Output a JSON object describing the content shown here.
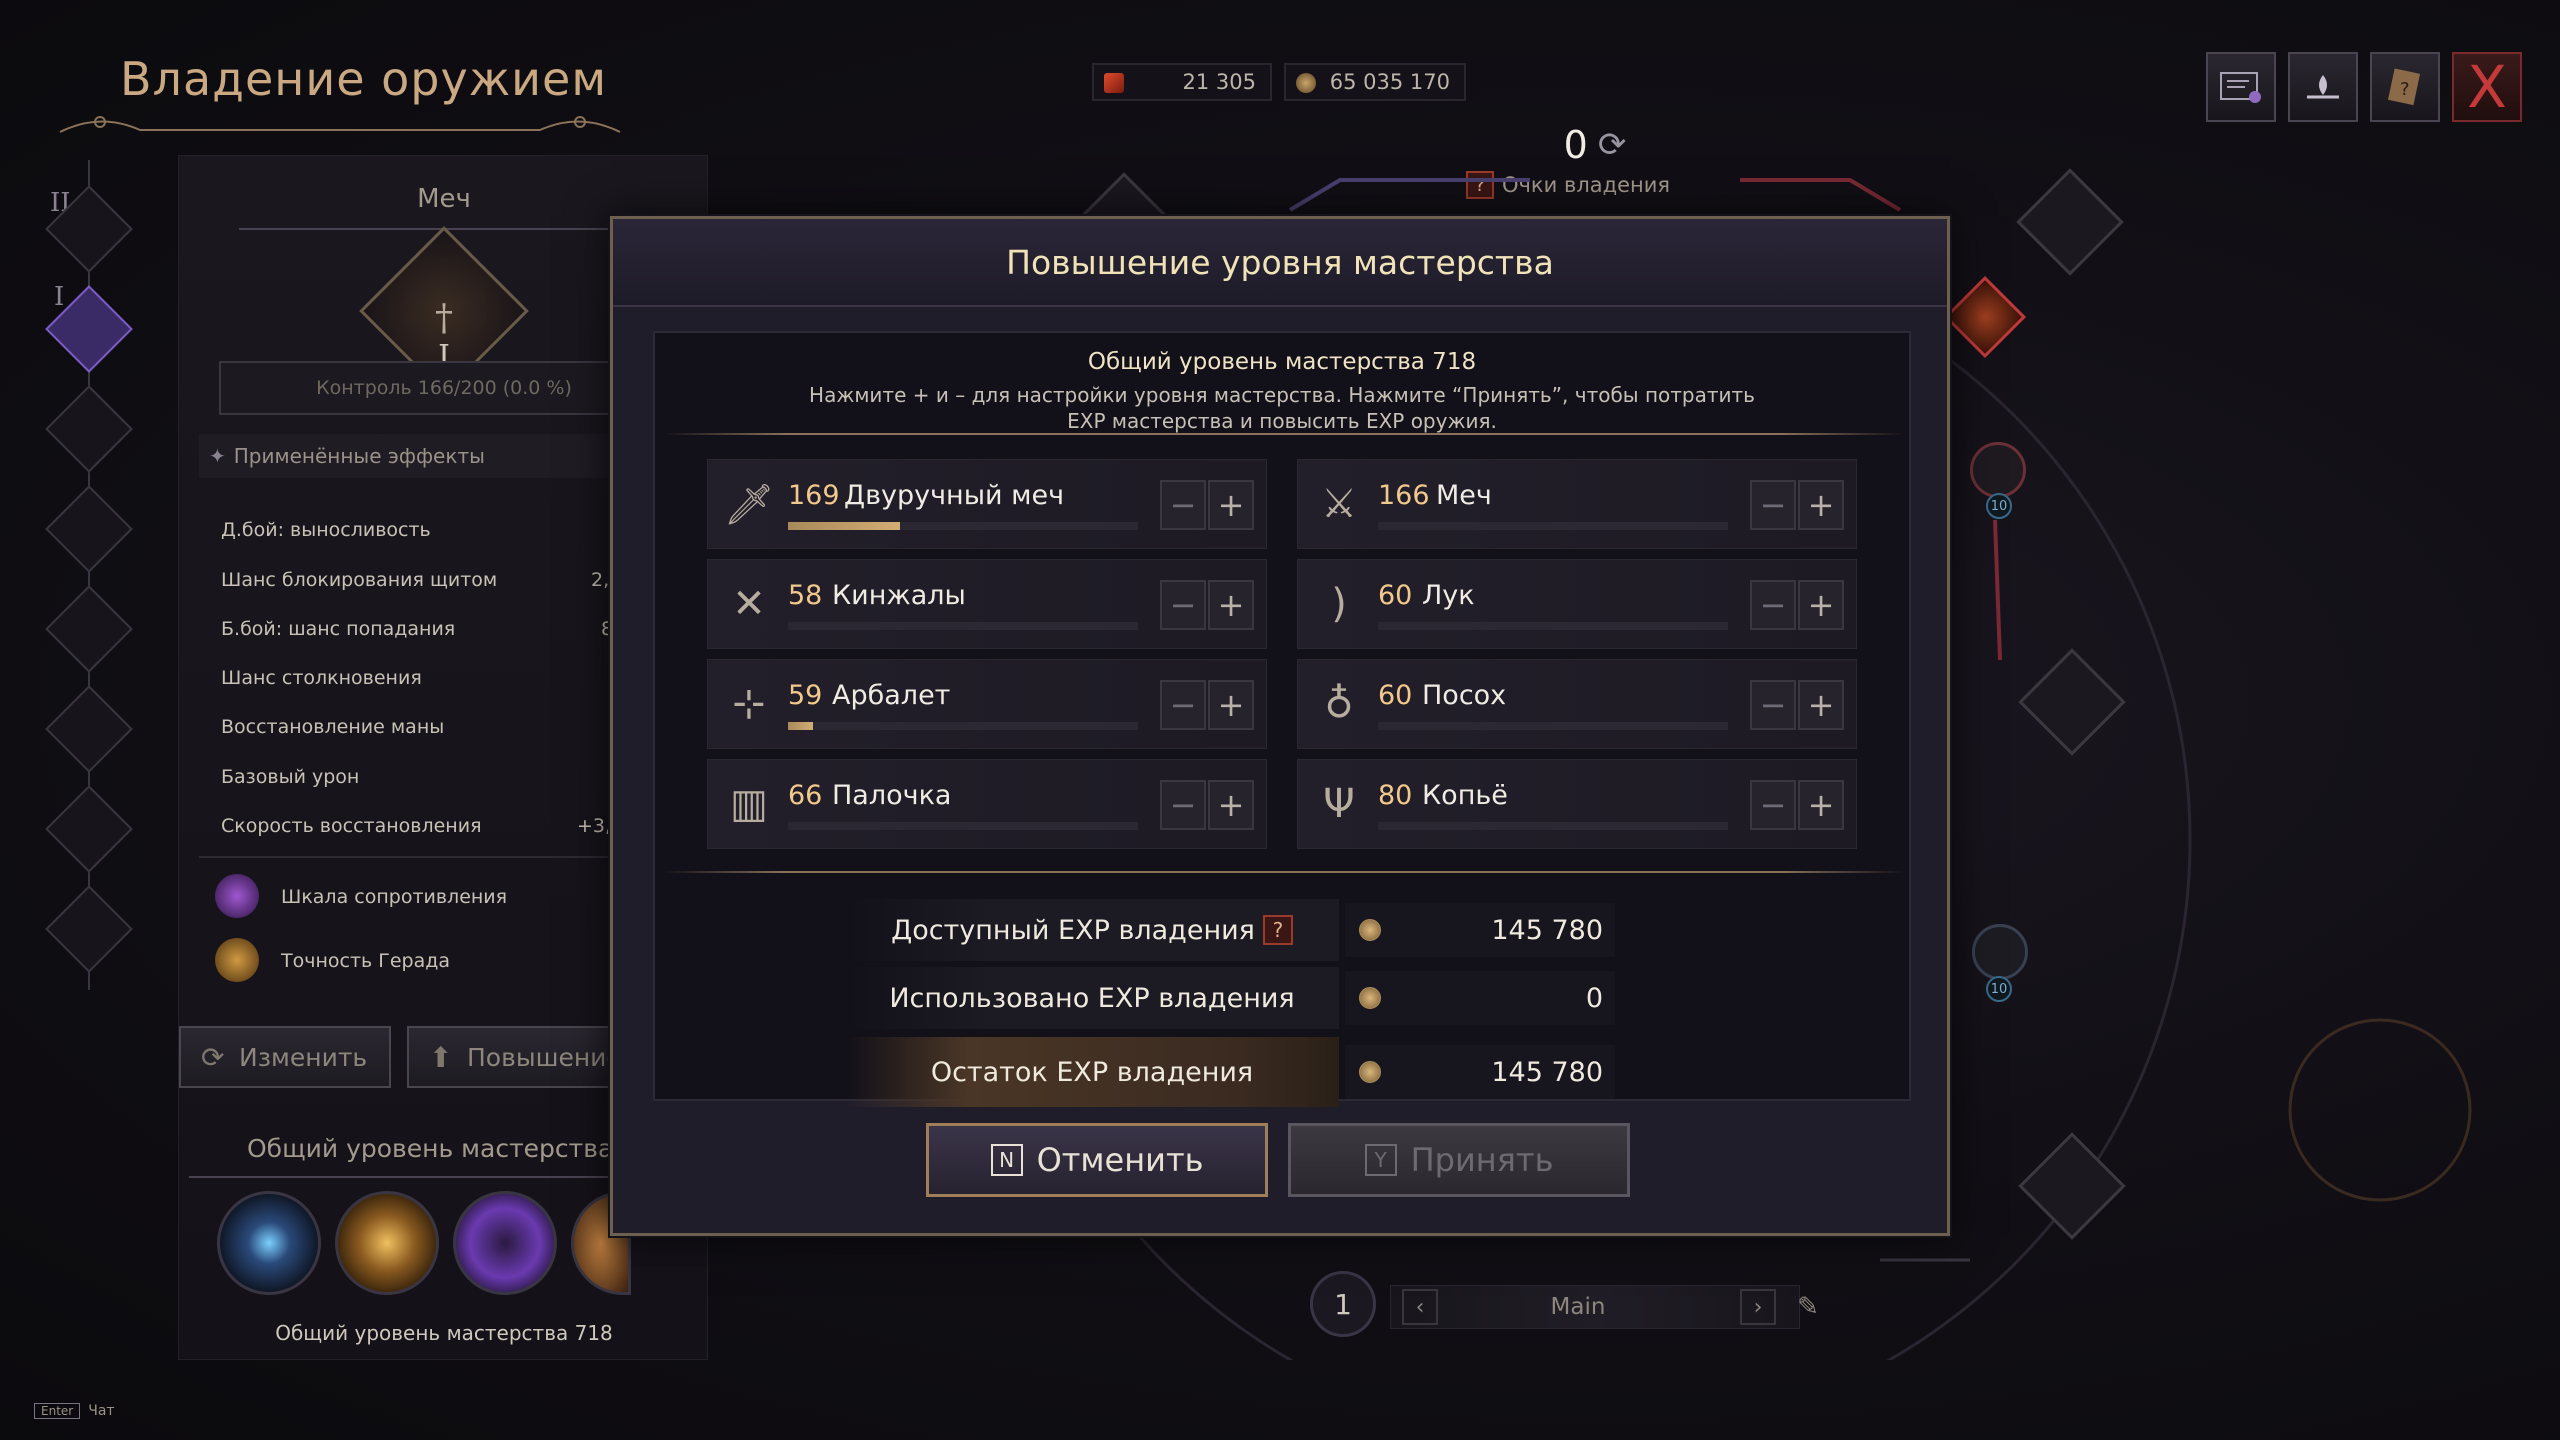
{
  "header": {
    "title": "Владение оружием"
  },
  "currencies": [
    {
      "icon": "arrow-flag-icon",
      "value": "21 305"
    },
    {
      "icon": "coin-icon",
      "value": "65 035 170"
    }
  ],
  "top_buttons": [
    {
      "icon": "document-icon"
    },
    {
      "icon": "lotus-icon"
    },
    {
      "icon": "quest-scroll-icon"
    },
    {
      "icon": "close-icon",
      "label": "X"
    }
  ],
  "points": {
    "count": "0",
    "label": "Очки владения"
  },
  "left_rail": {
    "tiers": [
      "II",
      "I"
    ]
  },
  "left_panel": {
    "weapon_title": "Меч",
    "emblem_label": "I",
    "control": "Контроль 166/200 (0.0 %)",
    "effects_label": "Применённые эффекты",
    "stats": [
      {
        "label": "Д.бой: выносливость",
        "value": ""
      },
      {
        "label": "Шанс блокирования щитом",
        "value": "2,"
      },
      {
        "label": "Б.бой: шанс попадания",
        "value": "8"
      },
      {
        "label": "Шанс столкновения",
        "value": ""
      },
      {
        "label": "Восстановление маны",
        "value": ""
      },
      {
        "label": "Базовый урон",
        "value": ""
      },
      {
        "label": "Скорость восстановления",
        "value": "+3,"
      }
    ],
    "special": [
      {
        "label": "Шкала сопротивления"
      },
      {
        "label": "Точность Герада"
      }
    ],
    "buttons": {
      "change": "Изменить",
      "upgrade": "Повышение"
    },
    "mastery_title": "Общий уровень мастерства",
    "mastery_footer": "Общий уровень мастерства 718"
  },
  "modal": {
    "title": "Повышение уровня мастерства",
    "overall": "Общий уровень мастерства 718",
    "hint_line1": "Нажмите + и – для настройки уровня мастерства. Нажмите “Принять”, чтобы потратить",
    "hint_line2": "EXP мастерства и повысить EXP оружия.",
    "weapons": [
      {
        "level": "169",
        "name": "Двуручный меч",
        "icon": "greatsword-icon",
        "progress": 0.32
      },
      {
        "level": "166",
        "name": "Меч",
        "icon": "sword-shield-icon",
        "progress": 0
      },
      {
        "level": "58",
        "name": "Кинжалы",
        "icon": "daggers-icon",
        "progress": 0
      },
      {
        "level": "60",
        "name": "Лук",
        "icon": "bow-icon",
        "progress": 0
      },
      {
        "level": "59",
        "name": "Арбалет",
        "icon": "crossbow-icon",
        "progress": 0.07
      },
      {
        "level": "60",
        "name": "Посох",
        "icon": "staff-icon",
        "progress": 0
      },
      {
        "level": "66",
        "name": "Палочка",
        "icon": "wand-icon",
        "progress": 0
      },
      {
        "level": "80",
        "name": "Копьё",
        "icon": "spear-icon",
        "progress": 0
      }
    ],
    "minus": "−",
    "plus": "+",
    "exp": {
      "available_label": "Доступный EXP владения",
      "available_value": "145 780",
      "used_label": "Использовано EXP владения",
      "used_value": "0",
      "remaining_label": "Остаток EXP владения",
      "remaining_value": "145 780"
    },
    "help": "?",
    "cancel": {
      "key": "N",
      "label": "Отменить"
    },
    "accept": {
      "key": "Y",
      "label": "Принять"
    }
  },
  "bottom_nav": {
    "page": "1",
    "name": "Main"
  },
  "node_badges": [
    "10",
    "10"
  ],
  "chat": {
    "key": "Enter",
    "label": "Чат"
  }
}
